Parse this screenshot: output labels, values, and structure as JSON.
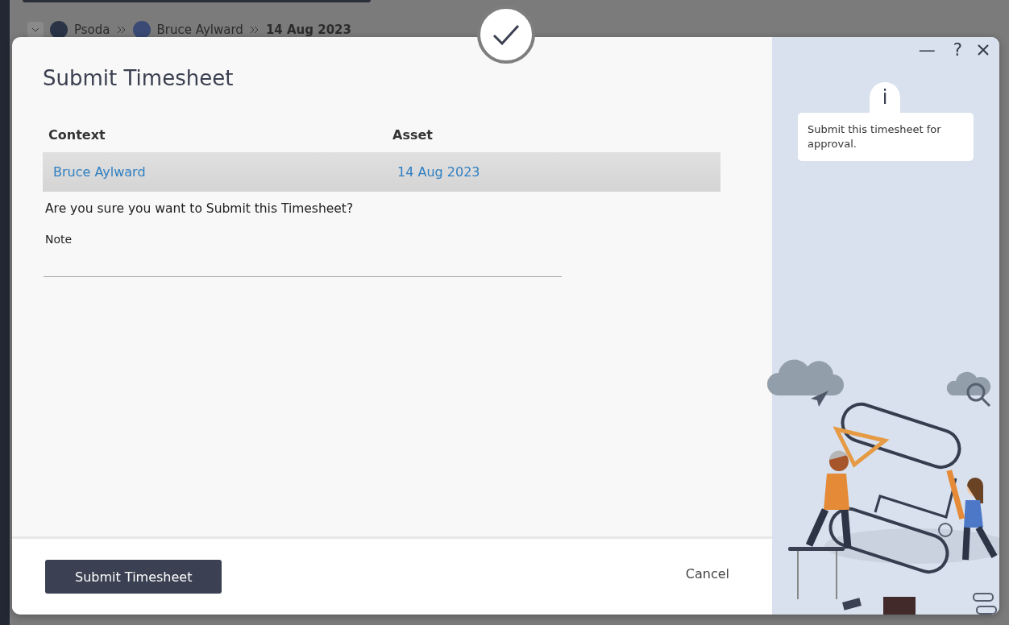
{
  "breadcrumb": [
    {
      "label": "Psoda",
      "kind": "logo"
    },
    {
      "label": "Bruce Aylward",
      "kind": "person"
    },
    {
      "label": "14 Aug 2023",
      "kind": "plain"
    }
  ],
  "dialog": {
    "title": "Submit Timesheet",
    "table": {
      "columns": [
        "Context",
        "Asset"
      ],
      "rows": [
        {
          "cells": [
            "Bruce Aylward",
            "14 Aug 2023"
          ],
          "selected": true
        }
      ]
    },
    "question": "Are you sure you want to Submit this Timesheet?",
    "note": {
      "label": "Note"
    },
    "primary_button": "Submit Timesheet",
    "cancel": "Cancel",
    "help": {
      "icon": "i",
      "text": "Submit this timesheet for approval."
    },
    "window_controls": [
      "—",
      "?"
    ]
  }
}
